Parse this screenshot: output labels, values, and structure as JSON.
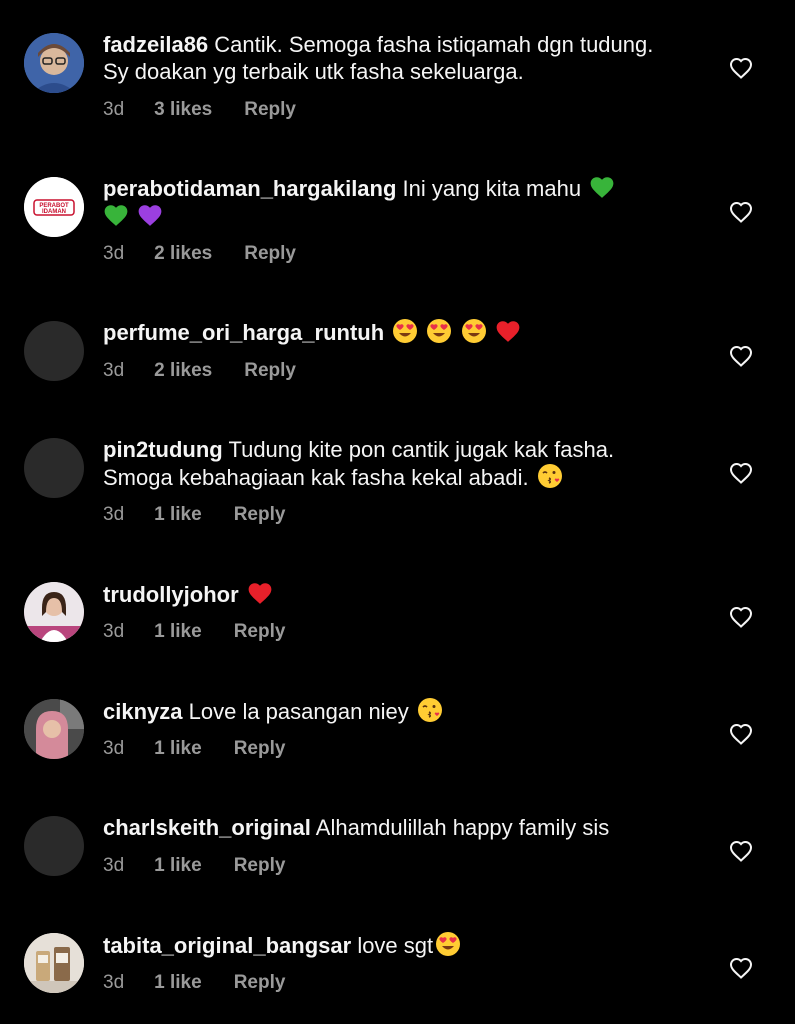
{
  "comments": [
    {
      "avatar": "photo-avatar-woman-glasses",
      "username": "fadzeila86",
      "text": "Cantik. Semoga fasha istiqamah dgn tudung. Sy doakan yg terbaik utk fasha sekeluarga.",
      "time": "3d",
      "likes": "3 likes",
      "reply": "Reply"
    },
    {
      "avatar": "logo-avatar-perabot-idaman",
      "avatar_text": "PERABOT IDAMAN",
      "username": "perabotidaman_hargakilang",
      "text": "Ini yang kita mahu",
      "emojis": [
        "green-heart",
        "green-heart",
        "purple-heart"
      ],
      "time": "3d",
      "likes": "2 likes",
      "reply": "Reply"
    },
    {
      "avatar": "default-avatar",
      "username": "perfume_ori_harga_runtuh",
      "text": "",
      "emojis": [
        "heart-eyes",
        "heart-eyes",
        "heart-eyes",
        "red-heart"
      ],
      "time": "3d",
      "likes": "2 likes",
      "reply": "Reply"
    },
    {
      "avatar": "default-avatar",
      "username": "pin2tudung",
      "text": "Tudung kite pon cantik jugak kak fasha. Smoga kebahagiaan kak fasha kekal abadi.",
      "emojis": [
        "kiss-face"
      ],
      "time": "3d",
      "likes": "1 like",
      "reply": "Reply"
    },
    {
      "avatar": "photo-avatar-woman-pink",
      "username": "trudollyjohor",
      "text": "",
      "emojis": [
        "red-heart"
      ],
      "time": "3d",
      "likes": "1 like",
      "reply": "Reply"
    },
    {
      "avatar": "photo-avatar-woman-hijab",
      "username": "ciknyza",
      "text": "Love la pasangan niey",
      "emojis": [
        "kiss-face"
      ],
      "time": "3d",
      "likes": "1 like",
      "reply": "Reply"
    },
    {
      "avatar": "default-avatar",
      "username": "charlskeith_original",
      "text": "Alhamdulillah happy family sis",
      "time": "3d",
      "likes": "1 like",
      "reply": "Reply"
    },
    {
      "avatar": "photo-avatar-product",
      "username": "tabita_original_bangsar",
      "text": "love sgt",
      "emojis": [
        "heart-eyes"
      ],
      "time": "3d",
      "likes": "1 like",
      "reply": "Reply"
    }
  ],
  "colors": {
    "background": "#000000",
    "text": "#f5f5f5",
    "muted": "#9a9a9a"
  }
}
